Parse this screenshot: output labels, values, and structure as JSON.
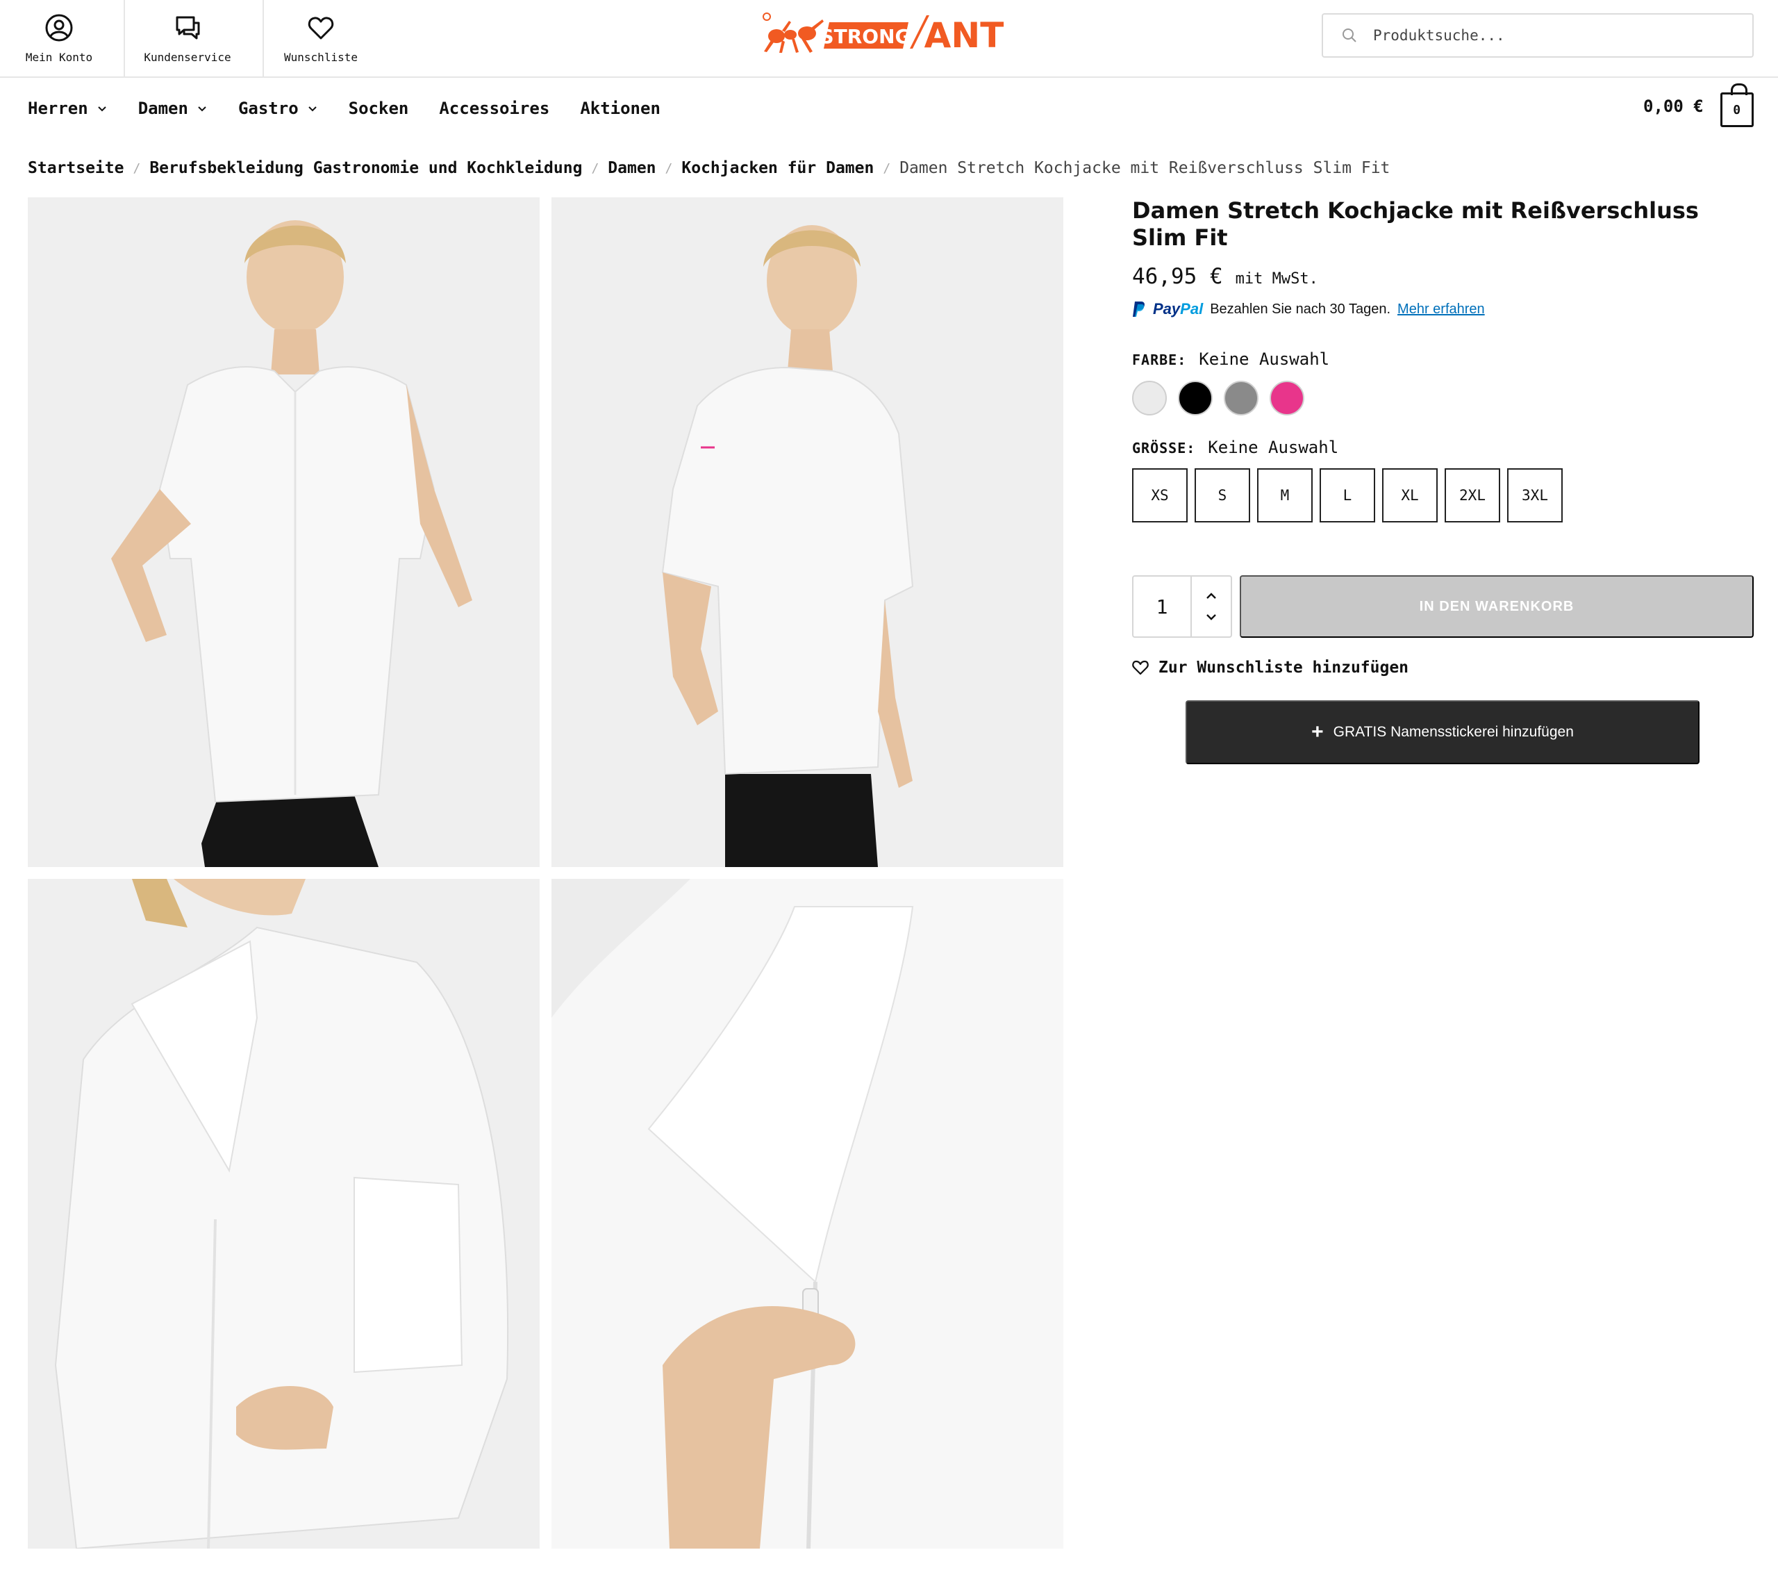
{
  "header": {
    "utility": [
      {
        "label": "Mein Konto",
        "icon": "user-circle-icon"
      },
      {
        "label": "Kundenservice",
        "icon": "chat-bubbles-icon"
      },
      {
        "label": "Wunschliste",
        "icon": "heart-icon"
      }
    ],
    "logo_text": "STRONG ANT",
    "search_placeholder": "Produktsuche..."
  },
  "nav": {
    "items": [
      {
        "label": "Herren",
        "has_dropdown": true
      },
      {
        "label": "Damen",
        "has_dropdown": true
      },
      {
        "label": "Gastro",
        "has_dropdown": true
      },
      {
        "label": "Socken",
        "has_dropdown": false
      },
      {
        "label": "Accessoires",
        "has_dropdown": false
      },
      {
        "label": "Aktionen",
        "has_dropdown": false
      }
    ],
    "cart_total": "0,00 €",
    "cart_count": "0"
  },
  "breadcrumb": {
    "items": [
      "Startseite",
      "Berufsbekleidung Gastronomie und Kochkleidung",
      "Damen",
      "Kochjacken für Damen"
    ],
    "separator": "/",
    "current": "Damen Stretch Kochjacke mit Reißverschluss Slim Fit"
  },
  "gallery": [
    "front-view-photo",
    "side-view-photo",
    "collar-closeup-photo",
    "zipper-closeup-photo"
  ],
  "product": {
    "title": "Damen Stretch Kochjacke mit Reißverschluss Slim Fit",
    "price": "46,95 €",
    "tax_note": "mit MwSt.",
    "paypal": {
      "brand_a": "Pay",
      "brand_b": "Pal",
      "text": "Bezahlen Sie nach 30 Tagen.",
      "link": "Mehr erfahren"
    },
    "color": {
      "label": "FARBE:",
      "value": "Keine Auswahl",
      "swatches": [
        {
          "name": "weiss",
          "hex": "#ebebeb"
        },
        {
          "name": "schwarz",
          "hex": "#000000"
        },
        {
          "name": "grau",
          "hex": "#8a8a8a"
        },
        {
          "name": "pink",
          "hex": "#e8358b"
        }
      ]
    },
    "size": {
      "label": "GRÖSSE:",
      "value": "Keine Auswahl",
      "options": [
        "XS",
        "S",
        "M",
        "L",
        "XL",
        "2XL",
        "3XL"
      ]
    },
    "quantity": "1",
    "add_to_cart": "IN DEN WARENKORB",
    "wishlist": "Zur Wunschliste hinzufügen",
    "embroidery": "GRATIS Namensstickerei hinzufügen"
  },
  "colors": {
    "brand_orange": "#f15a22",
    "dark_button": "#2a2a2a",
    "disabled_button": "#c8c8c8",
    "link_blue": "#0070ba"
  }
}
